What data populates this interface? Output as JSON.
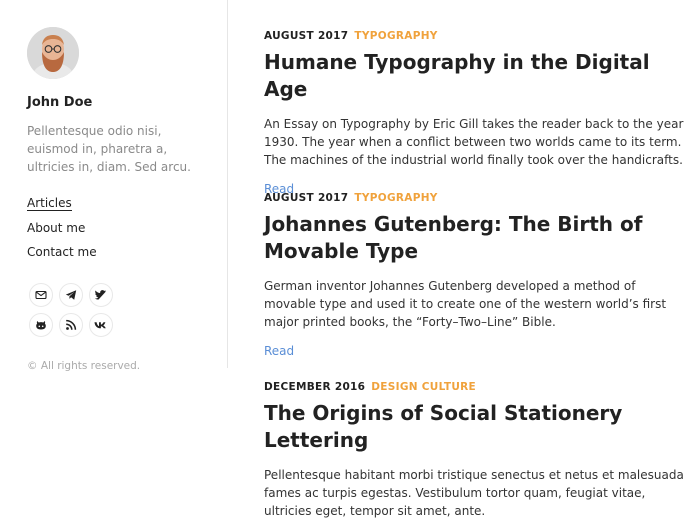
{
  "author": {
    "name": "John Doe",
    "bio": "Pellentesque odio nisi, euismod in, pharetra a, ultricies in, diam. Sed arcu."
  },
  "menu": [
    "Articles",
    "About me",
    "Contact me"
  ],
  "socials": [
    "email-icon",
    "telegram-icon",
    "twitter-icon",
    "github-icon",
    "rss-icon",
    "vk-icon"
  ],
  "copyright": "© All rights reserved.",
  "accent_color": "#f0a23c",
  "link_color": "#5a8ed6",
  "posts": [
    {
      "date": "AUGUST 2017",
      "category": "TYPOGRAPHY",
      "title": "Humane Typography in the Digital Age",
      "excerpt": "An Essay on Typography by Eric Gill takes the reader back to the year 1930. The year when a conflict between two worlds came to its term. The machines of the industrial world finally took over the handicrafts.",
      "read": "Read"
    },
    {
      "date": "AUGUST 2017",
      "category": "TYPOGRAPHY",
      "title": "Johannes Gutenberg: The Birth of Movable Type",
      "excerpt": "German inventor Johannes Gutenberg developed a method of movable type and used it to create one of the western world’s first major printed books, the “Forty–Two–Line” Bible.",
      "read": "Read"
    },
    {
      "date": "DECEMBER 2016",
      "category": "DESIGN CULTURE",
      "title": "The Origins of Social Stationery Lettering",
      "excerpt": "Pellentesque habitant morbi tristique senectus et netus et malesuada fames ac turpis egestas. Vestibulum tortor quam, feugiat vitae, ultricies eget, tempor sit amet, ante."
    }
  ]
}
